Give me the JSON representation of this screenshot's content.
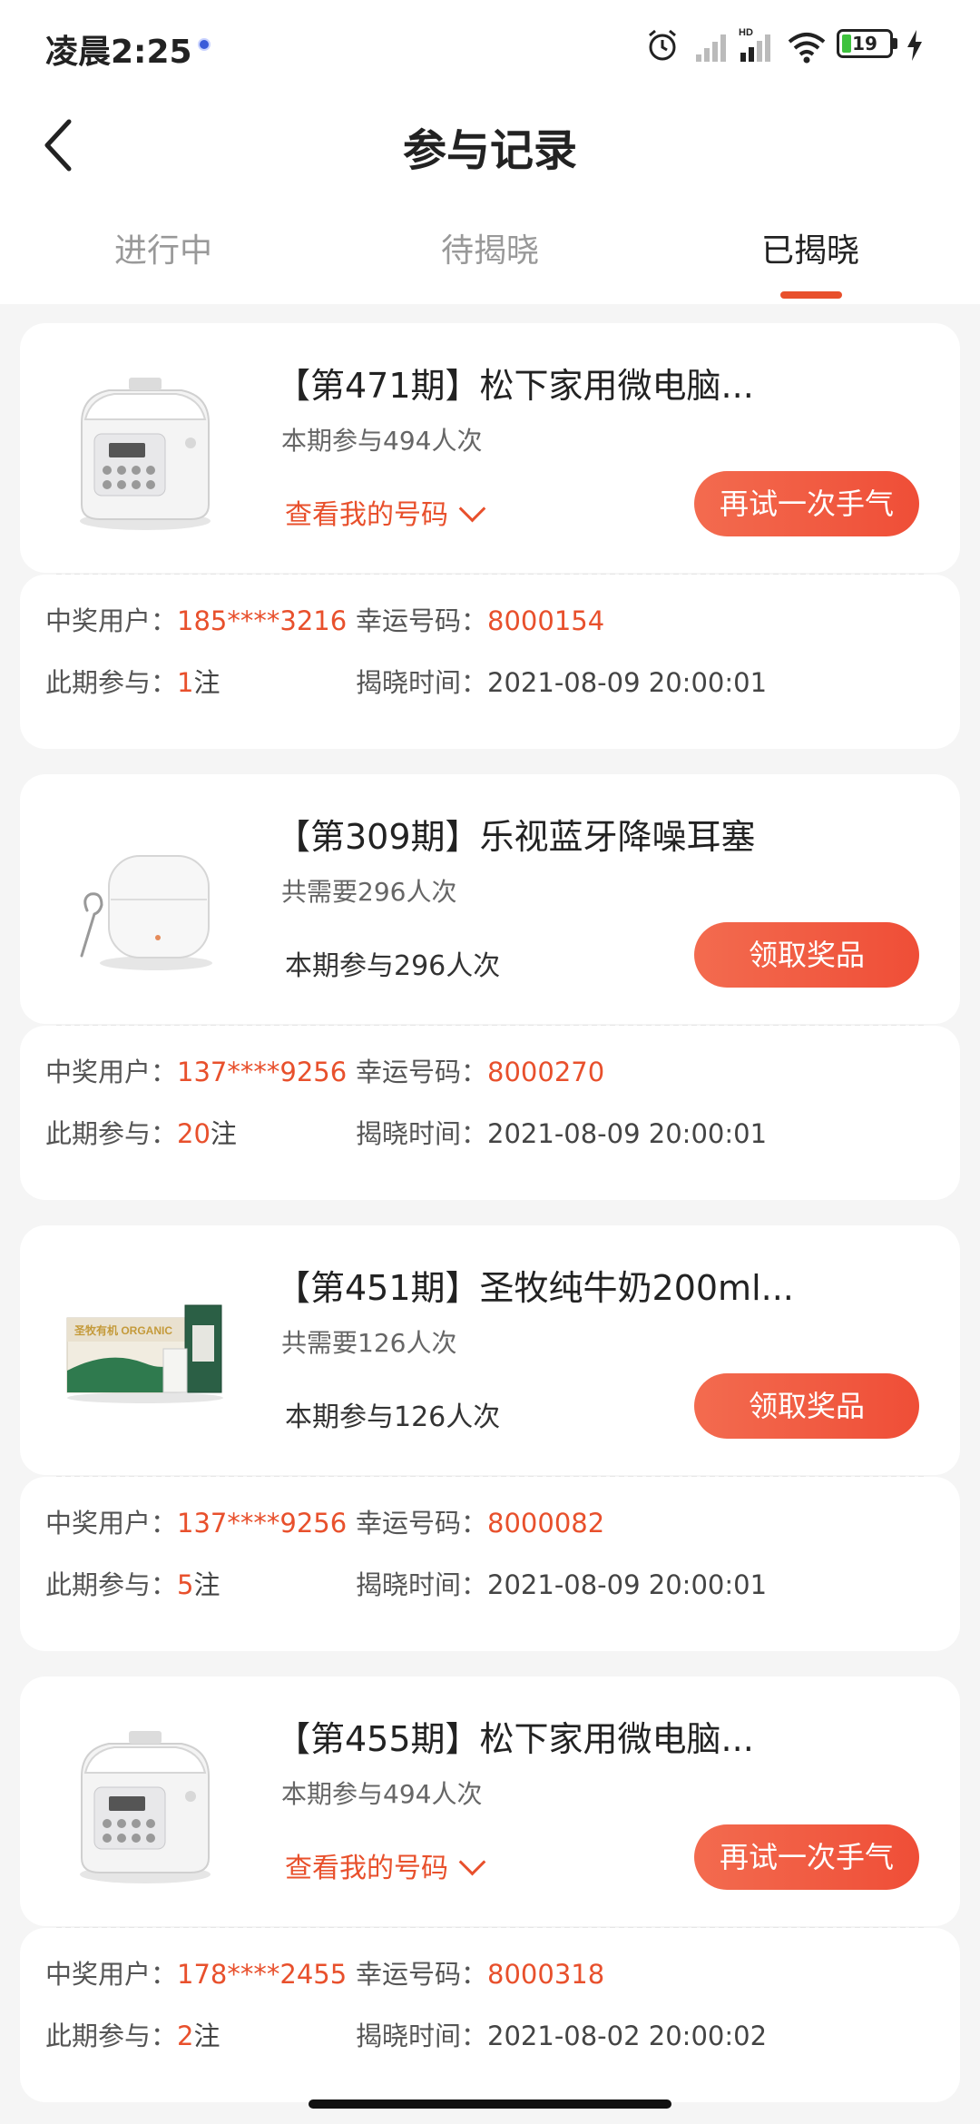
{
  "status": {
    "time": "凌晨2:25",
    "battery": "19"
  },
  "header": {
    "title": "参与记录"
  },
  "tabs": [
    {
      "label": "进行中"
    },
    {
      "label": "待揭晓"
    },
    {
      "label": "已揭晓"
    }
  ],
  "active_tab": "已揭晓",
  "labels": {
    "winner": "中奖用户：",
    "lucky": "幸运号码：",
    "participate": "此期参与：",
    "reveal": "揭晓时间：",
    "unit": "注",
    "view_code": "查看我的号码"
  },
  "cards": [
    {
      "title": "【第471期】松下家用微电脑...",
      "subtitle": "本期参与494人次",
      "info": "",
      "button": "再试一次手气",
      "winner": "185****3216",
      "lucky_number": "8000154",
      "count": "1",
      "reveal_time": "2021-08-09 20:00:01",
      "image": "rice-cooker"
    },
    {
      "title": "【第309期】乐视蓝牙降噪耳塞",
      "subtitle": "共需要296人次",
      "info": "本期参与296人次",
      "button": "领取奖品",
      "winner": "137****9256",
      "lucky_number": "8000270",
      "count": "20",
      "reveal_time": "2021-08-09 20:00:01",
      "image": "earbuds"
    },
    {
      "title": "【第451期】圣牧纯牛奶200ml...",
      "subtitle": "共需要126人次",
      "info": "本期参与126人次",
      "button": "领取奖品",
      "winner": "137****9256",
      "lucky_number": "8000082",
      "count": "5",
      "reveal_time": "2021-08-09 20:00:01",
      "image": "milk-box"
    },
    {
      "title": "【第455期】松下家用微电脑...",
      "subtitle": "本期参与494人次",
      "info": "",
      "button": "再试一次手气",
      "winner": "178****2455",
      "lucky_number": "8000318",
      "count": "2",
      "reveal_time": "2021-08-02 20:00:02",
      "image": "rice-cooker"
    }
  ],
  "colors": {
    "accent": "#e8502c",
    "background": "#f5f5f5"
  }
}
